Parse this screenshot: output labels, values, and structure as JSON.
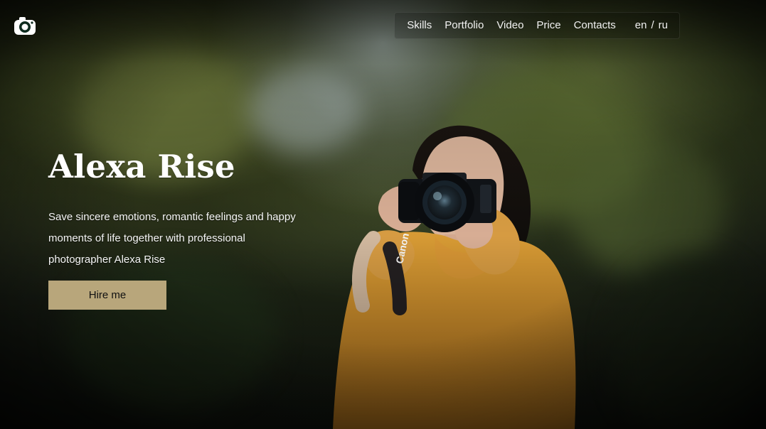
{
  "header": {
    "logo_icon": "camera-icon",
    "nav": {
      "skills": "Skills",
      "portfolio": "Portfolio",
      "video": "Video",
      "price": "Price",
      "contacts": "Contacts"
    },
    "languages": {
      "en": "en",
      "separator": "/",
      "ru": "ru"
    }
  },
  "hero": {
    "title": "Alexa Rise",
    "description": "Save sincere emotions, romantic feelings and happy moments of life together with professional photographer Alexa Rise",
    "button_label": "Hire me",
    "camera_strap_text": "Canon"
  },
  "colors": {
    "accent": "#b8a67b",
    "text": "#ffffff"
  }
}
